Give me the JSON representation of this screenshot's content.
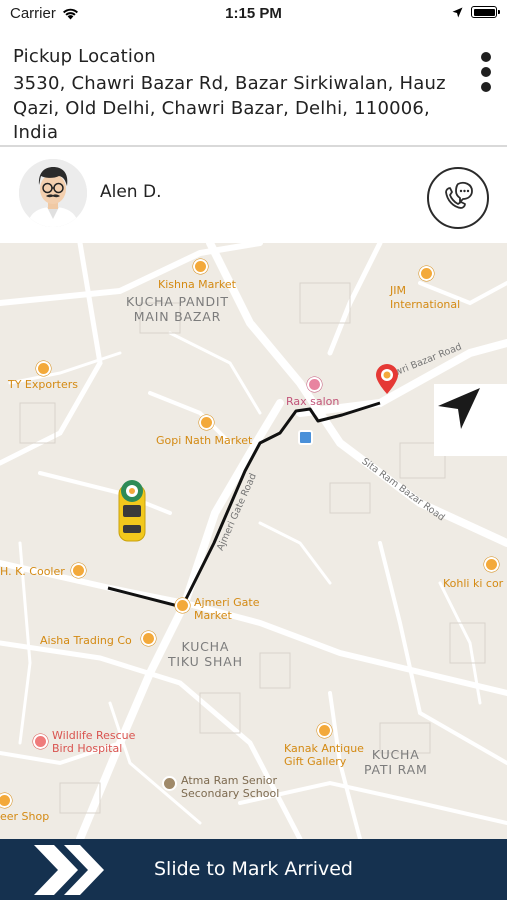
{
  "status_bar": {
    "carrier": "Carrier",
    "time": "1:15 PM"
  },
  "pickup": {
    "title": "Pickup Location",
    "address": "3530, Chawri Bazar Rd, Bazar Sirkiwalan, Hauz Qazi, Old Delhi, Chawri Bazar, Delhi, 110006, India"
  },
  "driver": {
    "name": "Alen D."
  },
  "map": {
    "areas": {
      "kucha_pandit": "KUCHA PANDIT\nMAIN BAZAR",
      "kucha_tiku": "KUCHA\nTIKU SHAH",
      "kucha_pati": "KUCHA\nPATI RAM"
    },
    "pois": {
      "kishna_market": "Kishna Market",
      "jim_international": "JIM\nInternational",
      "ty_exporters": "TY Exporters",
      "rax_salon": "Rax salon",
      "gopi_nath_market": "Gopi Nath Market",
      "hk_cooler": "H. K. Cooler",
      "ajmeri_gate_market": "Ajmeri Gate\nMarket",
      "aisha_trading": "Aisha Trading Co",
      "kohli_ki_corner": "Kohli ki cor",
      "wildlife_rescue": "Wildlife Rescue\nBird Hospital",
      "kanak_antique": "Kanak Antique\nGift Gallery",
      "atma_ram": "Atma Ram Senior\nSecondary School",
      "beer_shop": "eer Shop"
    },
    "streets": {
      "chawri_bazar_road": "Chawri Bazar Road",
      "ajmeri_gate_road": "Ajmeri Gate Road",
      "sita_ram_bazar_road": "Sita Ram Bazar Road"
    }
  },
  "slide": {
    "label": "Slide to Mark Arrived"
  },
  "colors": {
    "bottom_bar": "#15314f",
    "poi": "#d48a13",
    "destination_pin": "#e53935",
    "car": "#f2c81c",
    "route": "#111111"
  },
  "icons": {
    "wifi": "wifi-icon",
    "location_arrow": "location-arrow-icon",
    "battery": "battery-icon",
    "menu": "kebab-menu-icon",
    "call": "phone-chat-icon",
    "navigate": "navigation-arrow-icon",
    "slide": "double-chevron-icon"
  }
}
